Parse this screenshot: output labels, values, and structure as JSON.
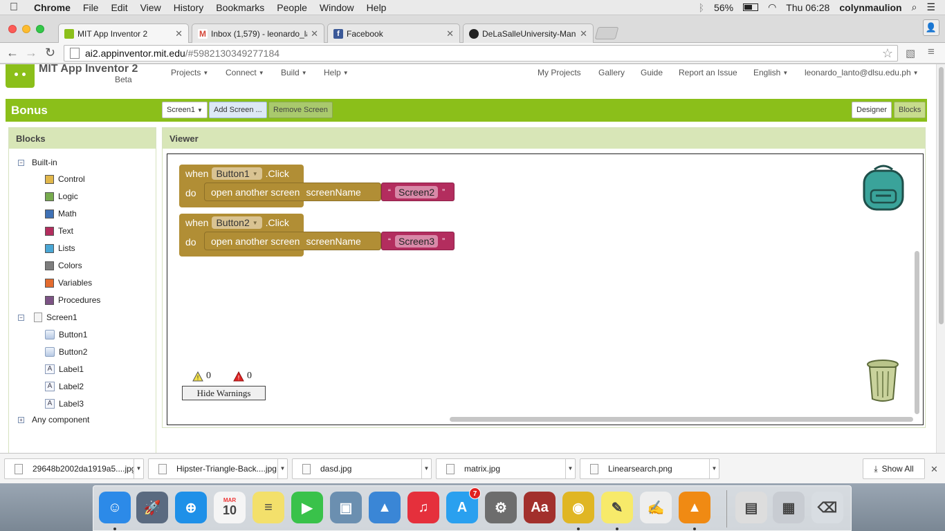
{
  "menubar": {
    "apple_icon": "apple-logo-icon",
    "app": "Chrome",
    "items": [
      "File",
      "Edit",
      "View",
      "History",
      "Bookmarks",
      "People",
      "Window",
      "Help"
    ],
    "battery": "56%",
    "clock": "Thu 06:28",
    "user": "colynmaulion"
  },
  "tabs": [
    {
      "title": "MIT App Inventor 2",
      "favicon_color": "#8bbf1a"
    },
    {
      "title": "Inbox (1,579) - leonardo_la",
      "favicon_color": "#d44638"
    },
    {
      "title": "Facebook",
      "favicon_color": "#3b5998"
    },
    {
      "title": "DeLaSalleUniversity-Manila",
      "favicon_color": "#222222"
    }
  ],
  "omnibox": {
    "host": "ai2.appinventor.mit.edu",
    "path": "/#5982130349277184"
  },
  "appnav": {
    "brand": "MIT App Inventor 2",
    "beta": "Beta",
    "left_menus": [
      "Projects",
      "Connect",
      "Build",
      "Help"
    ],
    "right_links": [
      "My Projects",
      "Gallery",
      "Guide",
      "Report an Issue"
    ],
    "language": "English",
    "account": "leonardo_lanto@dlsu.edu.ph"
  },
  "project": {
    "title": "Bonus",
    "screen_select": "Screen1",
    "add_screen": "Add Screen ...",
    "remove_screen": "Remove Screen",
    "designer": "Designer",
    "blocks": "Blocks"
  },
  "blocks_panel": {
    "title": "Blocks",
    "builtin_label": "Built-in",
    "builtin": [
      {
        "label": "Control",
        "color": "#e1b74b"
      },
      {
        "label": "Logic",
        "color": "#77ab4e"
      },
      {
        "label": "Math",
        "color": "#3f71b5"
      },
      {
        "label": "Text",
        "color": "#b32d5e"
      },
      {
        "label": "Lists",
        "color": "#49a6d4"
      },
      {
        "label": "Colors",
        "color": "#7d7d7d"
      },
      {
        "label": "Variables",
        "color": "#e36b2e"
      },
      {
        "label": "Procedures",
        "color": "#7c5385"
      }
    ],
    "screen_label": "Screen1",
    "components": [
      {
        "label": "Button1",
        "type": "button"
      },
      {
        "label": "Button2",
        "type": "button"
      },
      {
        "label": "Label1",
        "type": "label"
      },
      {
        "label": "Label2",
        "type": "label"
      },
      {
        "label": "Label3",
        "type": "label"
      }
    ],
    "any_component": "Any component"
  },
  "viewer": {
    "title": "Viewer",
    "blocks": [
      {
        "when": "when",
        "component": "Button1",
        "event": ".Click",
        "do": "do",
        "command": "open another screen",
        "param": "screenName",
        "value": "Screen2"
      },
      {
        "when": "when",
        "component": "Button2",
        "event": ".Click",
        "do": "do",
        "command": "open another screen",
        "param": "screenName",
        "value": "Screen3"
      }
    ],
    "warnings_count": "0",
    "errors_count": "0",
    "hide_warnings": "Hide Warnings"
  },
  "downloads": {
    "files": [
      "29648b2002da1919a5....jpg",
      "Hipster-Triangle-Back....jpg",
      "dasd.jpg",
      "matrix.jpg",
      "Linearsearch.png"
    ],
    "show_all": "Show All"
  },
  "dock": {
    "icons": [
      {
        "name": "finder-icon",
        "color": "#2c8ae8",
        "glyph": "☺"
      },
      {
        "name": "launchpad-icon",
        "color": "#5a6a80",
        "glyph": "🚀"
      },
      {
        "name": "safari-icon",
        "color": "#1e90e8",
        "glyph": "⊕"
      },
      {
        "name": "calendar-icon",
        "color": "#f5f5f5",
        "glyph": "10"
      },
      {
        "name": "notes-icon",
        "color": "#f3e06b",
        "glyph": "≡"
      },
      {
        "name": "facetime-icon",
        "color": "#39c24a",
        "glyph": "▶"
      },
      {
        "name": "iphoto-icon",
        "color": "#6b8fb0",
        "glyph": "▣"
      },
      {
        "name": "keynote-icon",
        "color": "#3a86d6",
        "glyph": "▲"
      },
      {
        "name": "itunes-icon",
        "color": "#e5303c",
        "glyph": "♫"
      },
      {
        "name": "app-store-icon",
        "color": "#2aa0ef",
        "glyph": "A"
      },
      {
        "name": "system-preferences-icon",
        "color": "#6d6d6d",
        "glyph": "⚙"
      },
      {
        "name": "dictionary-icon",
        "color": "#a2302c",
        "glyph": "Aa"
      },
      {
        "name": "chrome-icon",
        "color": "#e0b623",
        "glyph": "◉"
      },
      {
        "name": "stickies-icon",
        "color": "#f7ea6a",
        "glyph": "✎"
      },
      {
        "name": "textedit-icon",
        "color": "#eeeeee",
        "glyph": "✍"
      },
      {
        "name": "vlc-icon",
        "color": "#f08a13",
        "glyph": "▲"
      },
      {
        "name": "documents-stack-icon",
        "color": "#dddddd",
        "glyph": "▤"
      },
      {
        "name": "screenshots-stack-icon",
        "color": "#c8ccd2",
        "glyph": "▦"
      },
      {
        "name": "trash-icon",
        "color": "#d8dde2",
        "glyph": "⌫"
      }
    ],
    "app_store_badge": "7",
    "calendar_month": "MAR",
    "calendar_day": "10"
  }
}
